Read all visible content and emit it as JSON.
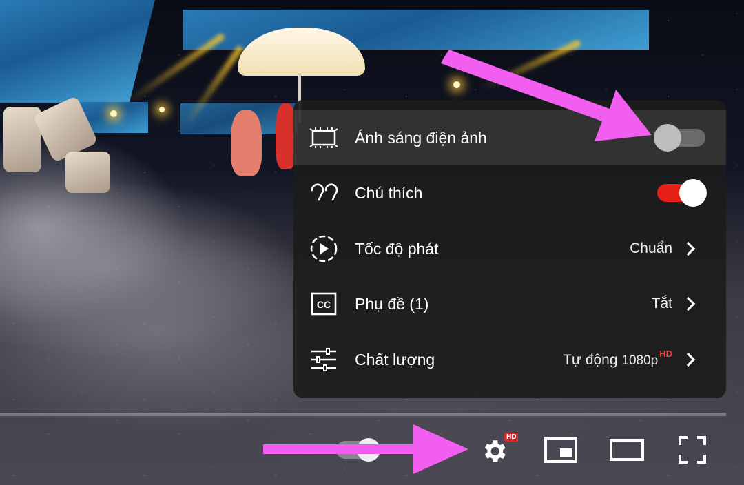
{
  "menu": {
    "items": [
      {
        "label": "Ánh sáng điện ảnh",
        "type": "toggle",
        "on": false,
        "icon": "ambient-mode-icon"
      },
      {
        "label": "Chú thích",
        "type": "toggle",
        "on": true,
        "icon": "annotations-quote-icon"
      },
      {
        "label": "Tốc độ phát",
        "type": "submenu",
        "value": "Chuẩn",
        "icon": "playback-speed-icon"
      },
      {
        "label": "Phụ đề (1)",
        "type": "submenu",
        "value": "Tắt",
        "icon": "cc-icon"
      },
      {
        "label": "Chất lượng",
        "type": "submenu",
        "value": "Tự động",
        "value_extra": "1080p",
        "value_badge": "HD",
        "icon": "sliders-icon"
      }
    ]
  },
  "controls": {
    "settings_badge": "HD",
    "icons": [
      "autoplay-toggle",
      "settings-gear-icon",
      "miniplayer-icon",
      "theater-mode-icon",
      "fullscreen-icon"
    ]
  },
  "colors": {
    "toggle_on": "#e62117",
    "toggle_off_track": "#6b6b6b",
    "annotation_arrow": "#f25ff0",
    "hd_badge": "#d52a2a"
  }
}
